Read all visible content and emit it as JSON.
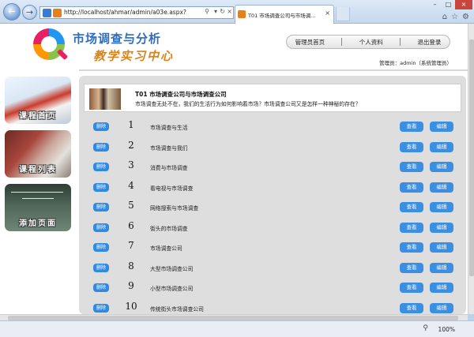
{
  "browser": {
    "url": "http://localhost/ahmar/admin/a03e.aspx?",
    "tab_title": "T01 市场调查公司与市场调...",
    "zoom": "100%"
  },
  "header": {
    "title_line1": "市场调查与分析",
    "title_line2": "教学实习中心",
    "nav": [
      "管理员首页",
      "个人资料",
      "退出登录"
    ],
    "admin_label": "管理员：admin（系统管理员）"
  },
  "sidebar": {
    "items": [
      {
        "label": "课程首页"
      },
      {
        "label": "课程列表"
      },
      {
        "label": "添加页面"
      }
    ]
  },
  "course": {
    "title": "T01 市场调查公司与市场调查公司",
    "desc": "市场调查无处不在，我们的生活行为如何影响着市场？市场调查公司又是怎样一种神秘的存在？"
  },
  "rows": [
    {
      "del": "删除",
      "num": "1",
      "title": "市场调查与生活",
      "view": "查看",
      "edit": "编辑"
    },
    {
      "del": "删除",
      "num": "2",
      "title": "市场调查与我们",
      "view": "查看",
      "edit": "编辑"
    },
    {
      "del": "删除",
      "num": "3",
      "title": "消费与市场调查",
      "view": "查看",
      "edit": "编辑"
    },
    {
      "del": "删除",
      "num": "4",
      "title": "看电视与市场调查",
      "view": "查看",
      "edit": "编辑"
    },
    {
      "del": "删除",
      "num": "5",
      "title": "网络搜索与市场调查",
      "view": "查看",
      "edit": "编辑"
    },
    {
      "del": "删除",
      "num": "6",
      "title": "街头的市场调查",
      "view": "查看",
      "edit": "编辑"
    },
    {
      "del": "删除",
      "num": "7",
      "title": "市场调查公司",
      "view": "查看",
      "edit": "编辑"
    },
    {
      "del": "删除",
      "num": "8",
      "title": "大型市场调查公司",
      "view": "查看",
      "edit": "编辑"
    },
    {
      "del": "删除",
      "num": "9",
      "title": "小型市场调查公司",
      "view": "查看",
      "edit": "编辑"
    },
    {
      "del": "删除",
      "num": "10",
      "title": "传统街头市场调查公司",
      "view": "查看",
      "edit": "编辑"
    }
  ]
}
